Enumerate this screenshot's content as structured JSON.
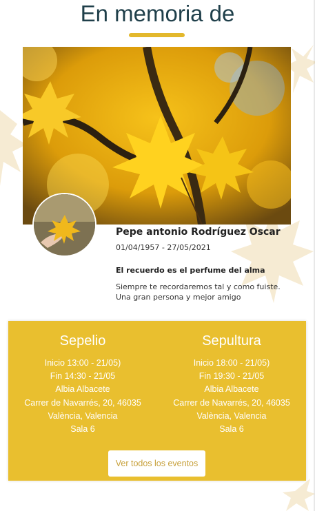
{
  "page": {
    "title": "En memoria de",
    "accent_color": "#e3b82c",
    "title_color": "#1f3f4a"
  },
  "hero": {
    "image_subject": "yellow-maple-leaves-photo"
  },
  "deceased": {
    "avatar_subject": "leaf-in-hand-photo",
    "name": "Pepe antonio Rodríguez Oscar",
    "dates": "01/04/1957 - 27/05/2021",
    "quote": "El recuerdo es el perfume del alma",
    "message": "Siempre te recordaremos tal y como fuiste. Una gran persona y mejor amigo"
  },
  "events": {
    "panel_color": "#e9bf2f",
    "sepelio": {
      "title": "Sepelio",
      "lines": [
        "Inicio 13:00 - 21/05)",
        "Fin 14:30 - 21/05",
        "Albia Albacete",
        "Carrer de Navarrés, 20, 46035",
        "València, Valencia",
        "Sala 6"
      ]
    },
    "sepultura": {
      "title": "Sepultura",
      "lines": [
        "Inicio 18:00 - 21/05)",
        "Fin 19:30 - 21/05",
        "Albia Albacete",
        "Carrer de Navarrés, 20, 46035",
        "València, Valencia",
        "Sala 6"
      ]
    },
    "all_events_label": "Ver todos los eventos"
  }
}
